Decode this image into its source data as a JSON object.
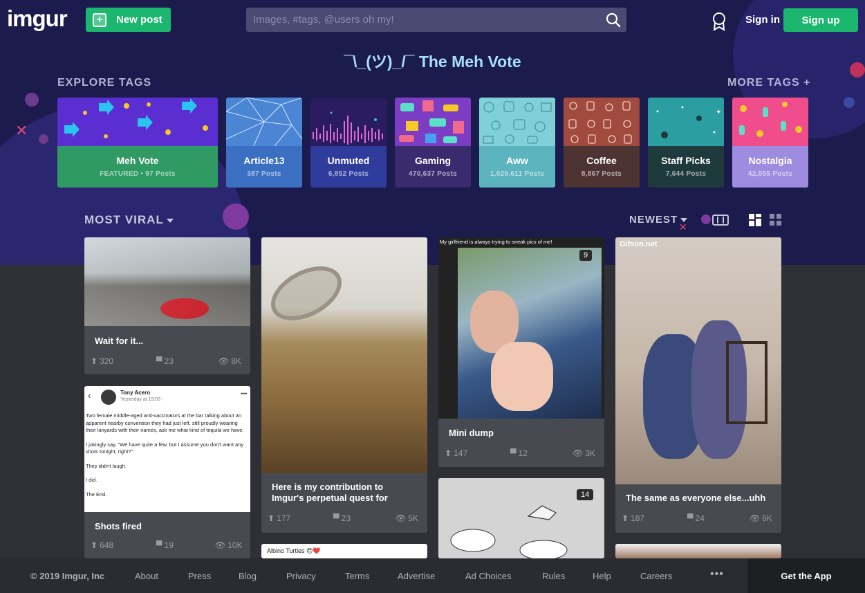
{
  "header": {
    "logo": "imgur",
    "new_post_label": "New post",
    "search_placeholder": "Images, #tags, @users oh my!",
    "sign_in_label": "Sign in",
    "sign_up_label": "Sign up"
  },
  "headline": "¯\\_(ツ)_/¯ The Meh Vote",
  "explore": {
    "label": "EXPLORE TAGS",
    "more_label": "MORE TAGS +",
    "tags": [
      {
        "name": "Meh Vote",
        "count": "FEATURED • 97 Posts",
        "color": "#2f9a64"
      },
      {
        "name": "Article13",
        "count": "387 Posts",
        "color": "#3a6fc2"
      },
      {
        "name": "Unmuted",
        "count": "6,852 Posts",
        "color": "#2f3c9c"
      },
      {
        "name": "Gaming",
        "count": "470,637 Posts",
        "color": "#3a2a6e"
      },
      {
        "name": "Aww",
        "count": "1,029,611 Posts",
        "color": "#5cb4be"
      },
      {
        "name": "Coffee",
        "count": "8,867 Posts",
        "color": "#4d3432"
      },
      {
        "name": "Staff Picks",
        "count": "7,644 Posts",
        "color": "#1e3a3c"
      },
      {
        "name": "Nostalgia",
        "count": "42,055 Posts",
        "color": "#9e8ce0"
      }
    ]
  },
  "sort": {
    "section_label": "MOST VIRAL",
    "order_label": "NEWEST"
  },
  "posts": [
    {
      "title": "Wait for it...",
      "ups": "320",
      "comments": "23",
      "views": "8K"
    },
    {
      "title": "Shots fired",
      "ups": "648",
      "comments": "19",
      "views": "10K",
      "fb_name": "Tony Acero",
      "fb_time": "Yesterday at 19:03 · ",
      "fb_text": [
        "Two female middle-aged anti-vaccinators at the bar talking about an apparent nearby convention they had just left, still proudly wearing their lanyards with their names, ask me what kind of tequila we have.",
        "I jokingly say, \"We have quite a few, but I assume you don't want any shots tonight, right?\"",
        "They didn't laugh.",
        "I did.",
        "The End."
      ]
    },
    {
      "title": "Here is my contribution to Imgur's perpetual quest for",
      "ups": "177",
      "comments": "23",
      "views": "5K"
    },
    {
      "title": "Albino Turtles 😍❤️"
    },
    {
      "title": "Mini dump",
      "ups": "147",
      "comments": "12",
      "views": "3K",
      "badge": "9",
      "caption": "My girlfriend is always trying to sneak pics of me!"
    },
    {
      "badge": "14"
    },
    {
      "title": "The same as everyone else...uhh",
      "ups": "187",
      "comments": "24",
      "views": "6K",
      "watermark": "Gifson.net"
    }
  ],
  "footer": {
    "copyright": "© 2019 Imgur, Inc",
    "links": [
      "About",
      "Press",
      "Blog",
      "Privacy",
      "Terms",
      "Advertise",
      "Ad Choices",
      "Rules",
      "Help",
      "Careers"
    ],
    "more": "•••",
    "get_app": "Get the App"
  }
}
